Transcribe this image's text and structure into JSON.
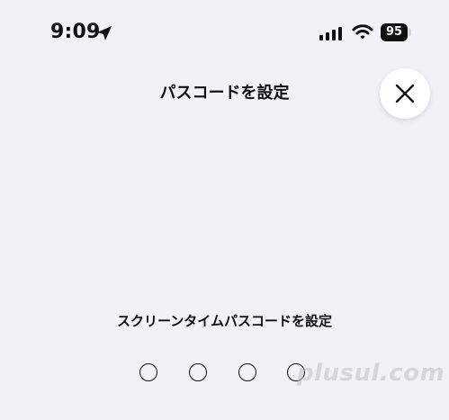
{
  "status_bar": {
    "time": "9:09",
    "location_icon": "location-arrow-icon",
    "signal_icon": "cellular-signal-icon",
    "wifi_icon": "wifi-icon",
    "battery_percent": "95"
  },
  "header": {
    "title": "パスコードを設定",
    "close_icon": "close-icon"
  },
  "main": {
    "prompt": "スクリーンタイムパスコードを設定",
    "passcode_length": 4,
    "entered_digits": 0
  },
  "watermark": {
    "text": "plusul.com"
  },
  "colors": {
    "background": "#f2f1f6",
    "text": "#111111",
    "close_button_bg": "#ffffff"
  }
}
